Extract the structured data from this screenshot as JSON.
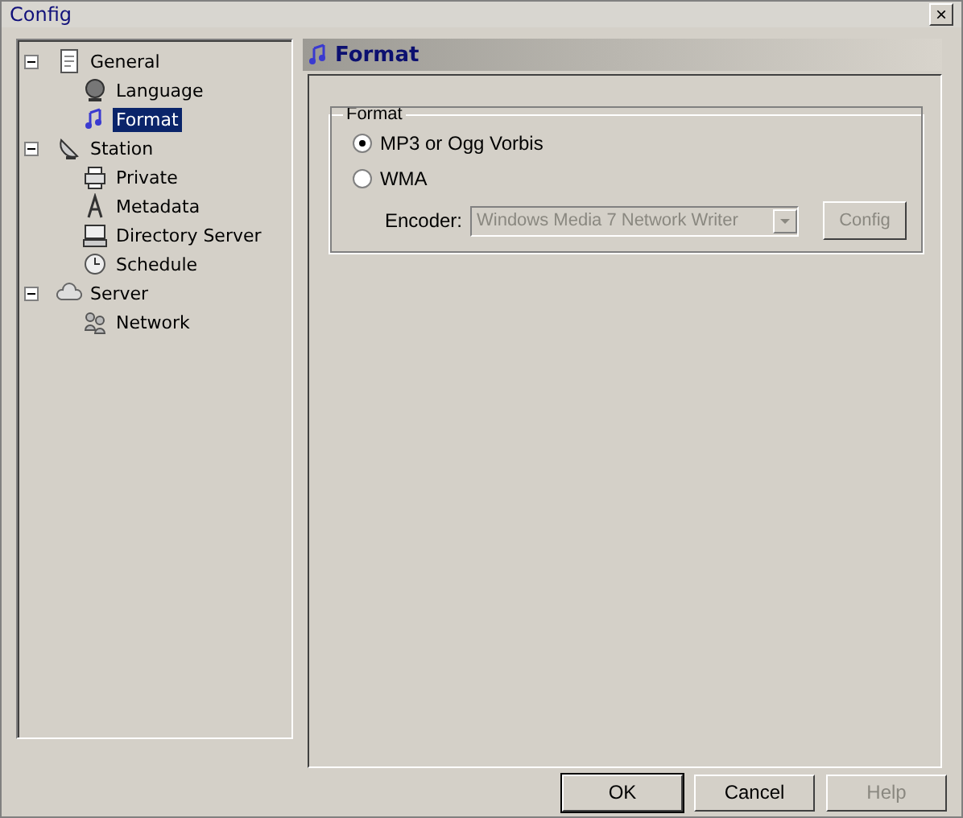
{
  "window": {
    "title": "Config",
    "close": "×"
  },
  "tree": [
    {
      "label": "General",
      "kind": "document",
      "expanded": true,
      "selected": false,
      "children": [
        {
          "label": "Language",
          "kind": "globe",
          "selected": false
        },
        {
          "label": "Format",
          "kind": "note",
          "selected": true
        }
      ]
    },
    {
      "label": "Station",
      "kind": "dish",
      "expanded": true,
      "selected": false,
      "children": [
        {
          "label": "Private",
          "kind": "printer",
          "selected": false
        },
        {
          "label": "Metadata",
          "kind": "letter",
          "selected": false
        },
        {
          "label": "Directory Server",
          "kind": "computer",
          "selected": false
        },
        {
          "label": "Schedule",
          "kind": "clock",
          "selected": false
        }
      ]
    },
    {
      "label": "Server",
      "kind": "cloud",
      "expanded": true,
      "selected": false,
      "children": [
        {
          "label": "Network",
          "kind": "people",
          "selected": false
        }
      ]
    }
  ],
  "panel": {
    "title": "Format",
    "group": {
      "title": "Format",
      "options": [
        {
          "label": "MP3 or Ogg Vorbis",
          "selected": true
        },
        {
          "label": "WMA",
          "selected": false
        }
      ],
      "encoder": {
        "label": "Encoder:",
        "value": "Windows Media 7 Network Writer",
        "disabled": true
      },
      "config_button": {
        "label": "Config",
        "disabled": true
      }
    }
  },
  "buttons": [
    {
      "label": "OK",
      "default": true,
      "disabled": false
    },
    {
      "label": "Cancel",
      "default": false,
      "disabled": false
    },
    {
      "label": "Help",
      "default": false,
      "disabled": true
    }
  ]
}
